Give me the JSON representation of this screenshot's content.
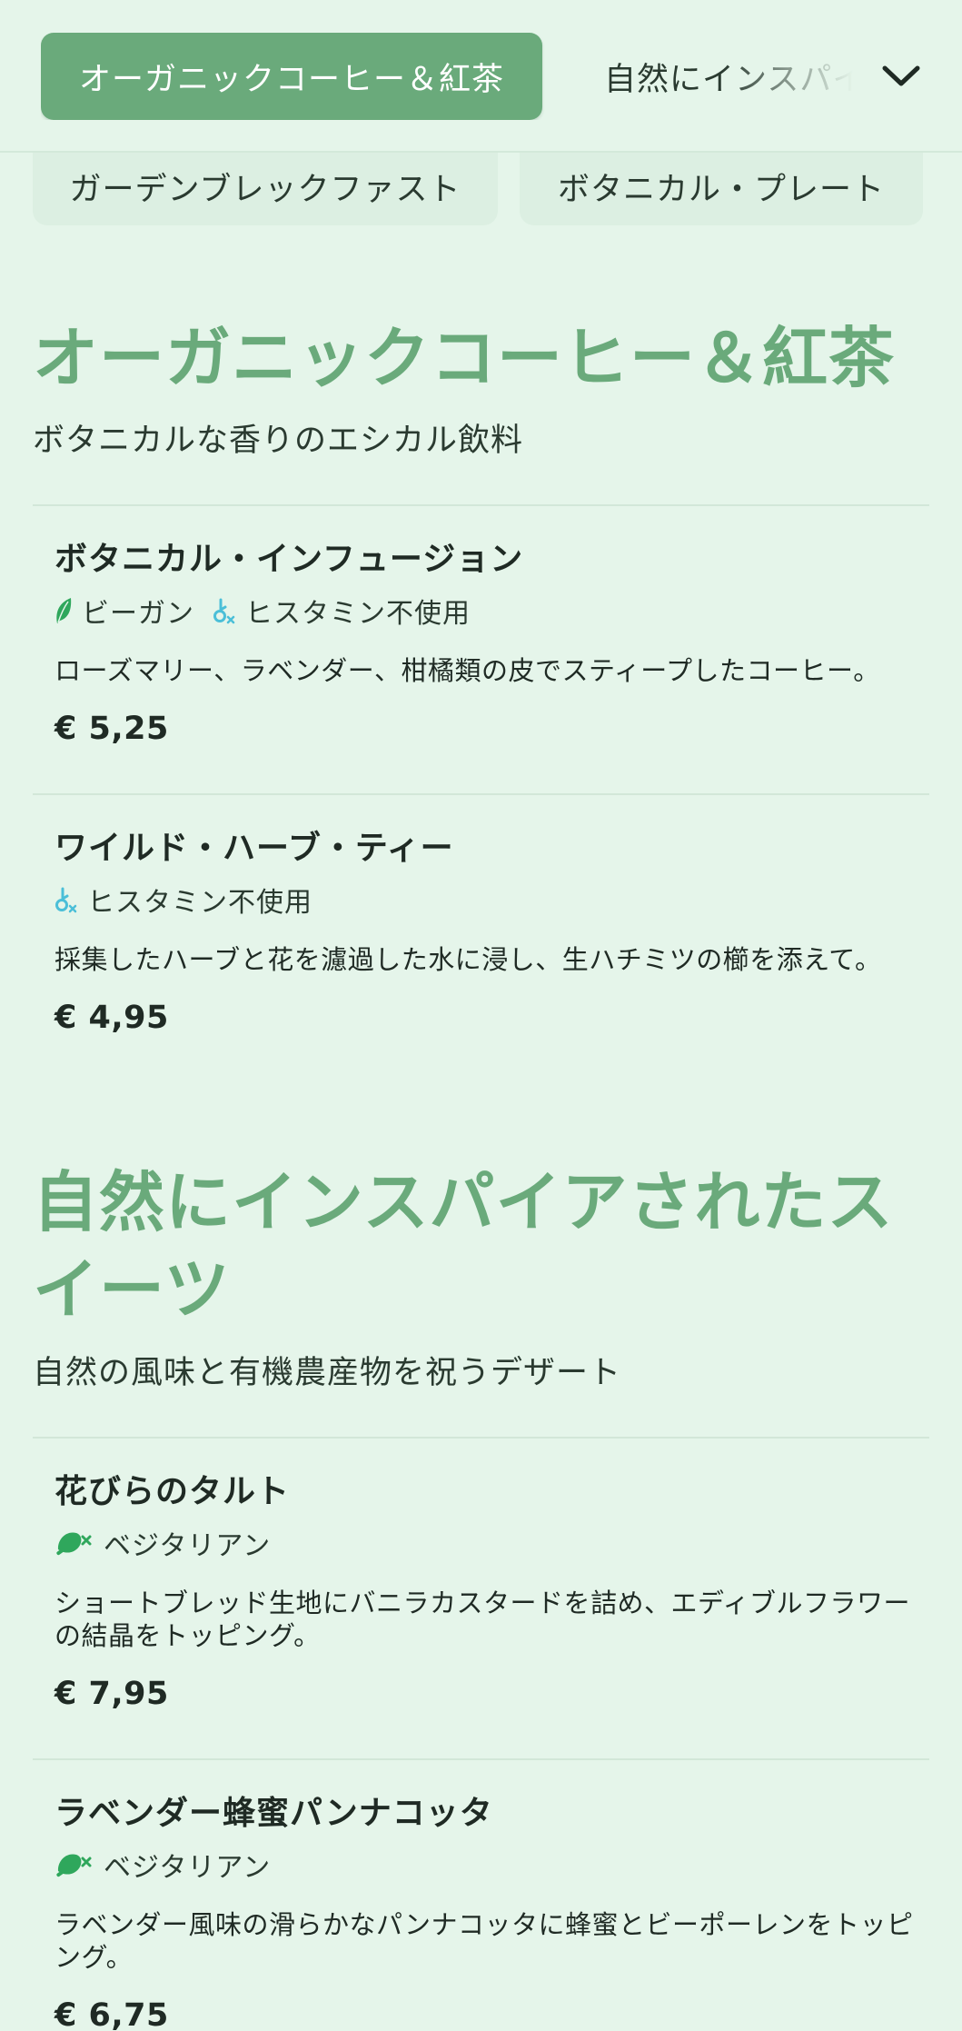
{
  "nav": {
    "active_tab": "オーガニックコーヒー＆紅茶",
    "next_tab": "自然にインスパイアされたスイーツ",
    "chips": [
      "ガーデンブレックファスト",
      "ボタニカル・プレート"
    ]
  },
  "colors": {
    "accent": "#6aaa7b",
    "background": "#e5f5ea",
    "vegan_leaf": "#2fa75c",
    "histamine": "#4bbfd8"
  },
  "sections": [
    {
      "title": "オーガニックコーヒー＆紅茶",
      "subtitle": "ボタニカルな香りのエシカル飲料",
      "items": [
        {
          "name": "ボタニカル・インフュージョン",
          "tags": [
            {
              "icon": "vegan-leaf-icon",
              "label": "ビーガン"
            },
            {
              "icon": "histamine-free-icon",
              "label": "ヒスタミン不使用"
            }
          ],
          "description": "ローズマリー、ラベンダー、柑橘類の皮でスティープしたコーヒー。",
          "price": "€ 5,25"
        },
        {
          "name": "ワイルド・ハーブ・ティー",
          "tags": [
            {
              "icon": "histamine-free-icon",
              "label": "ヒスタミン不使用"
            }
          ],
          "description": "採集したハーブと花を濾過した水に浸し、生ハチミツの櫛を添えて。",
          "price": "€ 4,95"
        }
      ]
    },
    {
      "title": "自然にインスパイアされたスイーツ",
      "subtitle": "自然の風味と有機農産物を祝うデザート",
      "items": [
        {
          "name": "花びらのタルト",
          "tags": [
            {
              "icon": "vegetarian-icon",
              "label": "ベジタリアン"
            }
          ],
          "description": "ショートブレッド生地にバニラカスタードを詰め、エディブルフラワーの結晶をトッピング。",
          "price": "€ 7,95"
        },
        {
          "name": "ラベンダー蜂蜜パンナコッタ",
          "tags": [
            {
              "icon": "vegetarian-icon",
              "label": "ベジタリアン"
            }
          ],
          "description": "ラベンダー風味の滑らかなパンナコッタに蜂蜜とビーポーレンをトッピング。",
          "price": "€ 6,75"
        }
      ]
    }
  ]
}
